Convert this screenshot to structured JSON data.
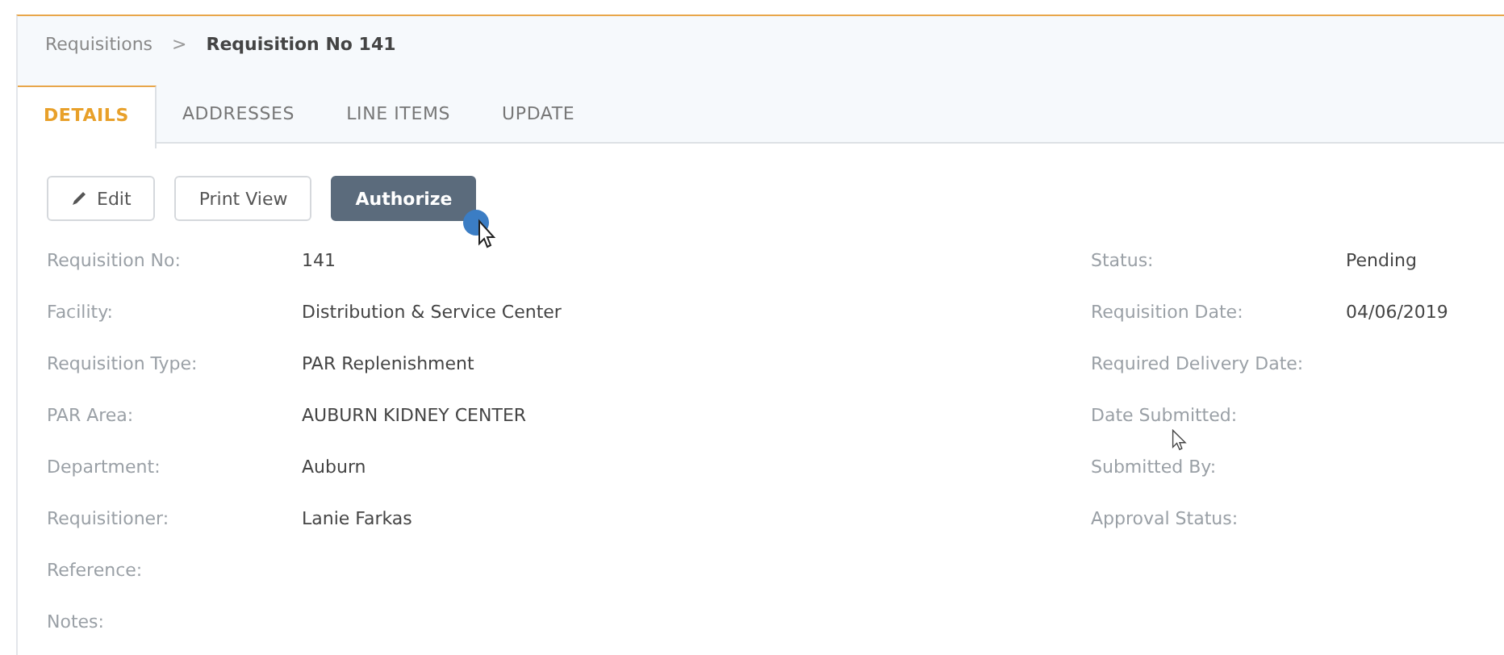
{
  "breadcrumb": {
    "parent": "Requisitions",
    "separator": ">",
    "current": "Requisition No 141"
  },
  "tabs": [
    {
      "label": "DETAILS",
      "selected": true
    },
    {
      "label": "ADDRESSES",
      "selected": false
    },
    {
      "label": "LINE ITEMS",
      "selected": false
    },
    {
      "label": "UPDATE",
      "selected": false
    }
  ],
  "buttons": [
    {
      "label": "Edit",
      "kind": "edit"
    },
    {
      "label": "Print View",
      "kind": "plain"
    },
    {
      "label": "Authorize",
      "kind": "primary"
    }
  ],
  "fields_left": [
    {
      "label": "Requisition No:",
      "value": "141"
    },
    {
      "label": "Facility:",
      "value": "Distribution & Service Center"
    },
    {
      "label": "Requisition Type:",
      "value": "PAR Replenishment"
    },
    {
      "label": "PAR Area:",
      "value": "AUBURN KIDNEY CENTER"
    },
    {
      "label": "Department:",
      "value": "Auburn"
    },
    {
      "label": "Requisitioner:",
      "value": "Lanie Farkas"
    },
    {
      "label": "Reference:"
    },
    {
      "label": "Notes:"
    }
  ],
  "fields_right": [
    {
      "label": "Status:",
      "value": "Pending"
    },
    {
      "label": "Requisition Date:",
      "value": "04/06/2019"
    },
    {
      "label": "Required Delivery Date:"
    },
    {
      "label": "Date Submitted:"
    },
    {
      "label": "Submitted By:"
    },
    {
      "label": "Approval Status:"
    }
  ]
}
